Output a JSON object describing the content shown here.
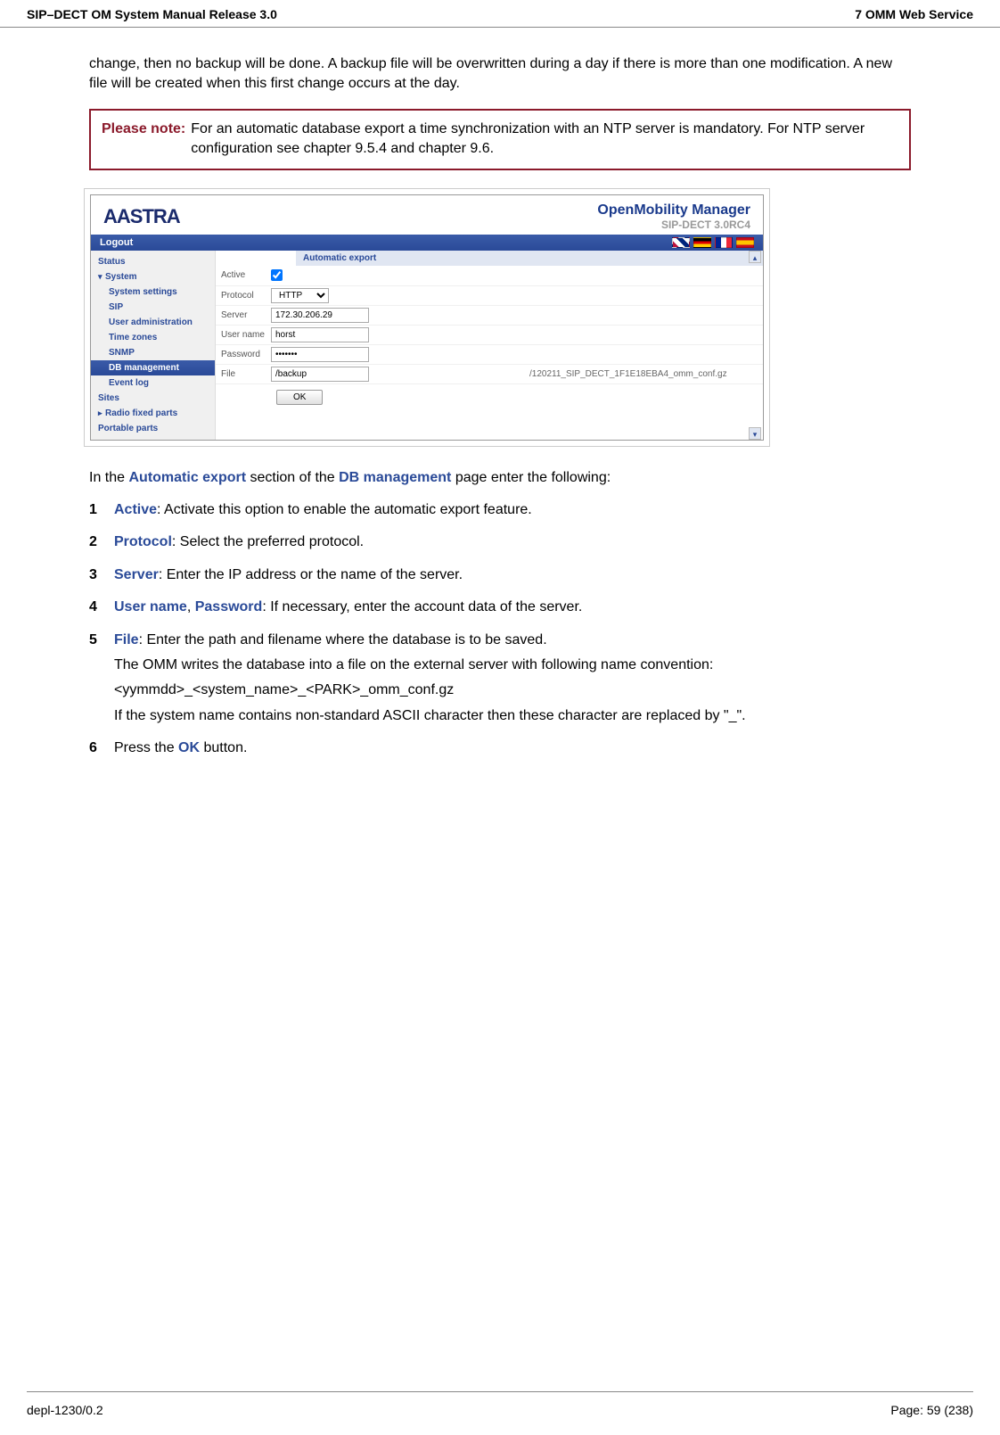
{
  "header": {
    "left": "SIP–DECT OM System Manual Release 3.0",
    "right": "7 OMM Web Service"
  },
  "top_paragraph": "change, then no backup will be done. A backup file will be overwritten during a day if there is more than one modification. A new file will be created when this first change occurs at the day.",
  "note": {
    "label": "Please note:",
    "text": "For an automatic database export a time synchronization with an NTP server is mandatory. For NTP server configuration see chapter 9.5.4 and chapter 9.6."
  },
  "app": {
    "brand": "AASTRA",
    "title": "OpenMobility Manager",
    "subtitle": "SIP-DECT 3.0RC4",
    "logout": "Logout",
    "sidebar": {
      "status": "Status",
      "system": "System",
      "system_settings": "System settings",
      "sip": "SIP",
      "user_admin": "User administration",
      "time_zones": "Time zones",
      "snmp": "SNMP",
      "db_management": "DB management",
      "event_log": "Event log",
      "sites": "Sites",
      "radio": "Radio fixed parts",
      "portable": "Portable parts"
    },
    "section_title": "Automatic export",
    "form": {
      "active_label": "Active",
      "protocol_label": "Protocol",
      "protocol_value": "HTTP",
      "server_label": "Server",
      "server_value": "172.30.206.29",
      "username_label": "User name",
      "username_value": "horst",
      "password_label": "Password",
      "password_value": "•••••••",
      "file_label": "File",
      "file_value": "/backup",
      "file_suffix": "/120211_SIP_DECT_1F1E18EBA4_omm_conf.gz",
      "ok_label": "OK"
    }
  },
  "intro": {
    "prefix": "In the ",
    "bold1": "Automatic export",
    "mid": " section of the ",
    "bold2": "DB management",
    "suffix": " page enter the following:"
  },
  "items": {
    "n1": "1",
    "i1_bold": "Active",
    "i1_text": ": Activate this option to enable the automatic export feature.",
    "n2": "2",
    "i2_bold": "Protocol",
    "i2_text": ": Select the preferred protocol.",
    "n3": "3",
    "i3_bold": "Server",
    "i3_text": ": Enter the IP address or the name of the server.",
    "n4": "4",
    "i4_bold1": "User name",
    "i4_sep": ", ",
    "i4_bold2": "Password",
    "i4_text": ": If necessary, enter the account data of the server.",
    "n5": "5",
    "i5_bold": "File",
    "i5_text": ": Enter the path and filename where the database is to be saved.",
    "i5_p2": "The OMM writes the database into a file on the external server with following name convention:",
    "i5_p3": "<yymmdd>_<system_name>_<PARK>_omm_conf.gz",
    "i5_p4": "If the system name contains non-standard ASCII character then these character are replaced by \"_\".",
    "n6": "6",
    "i6_prefix": "Press the ",
    "i6_bold": "OK",
    "i6_suffix": " button."
  },
  "footer": {
    "left": "depl-1230/0.2",
    "right": "Page: 59 (238)"
  }
}
